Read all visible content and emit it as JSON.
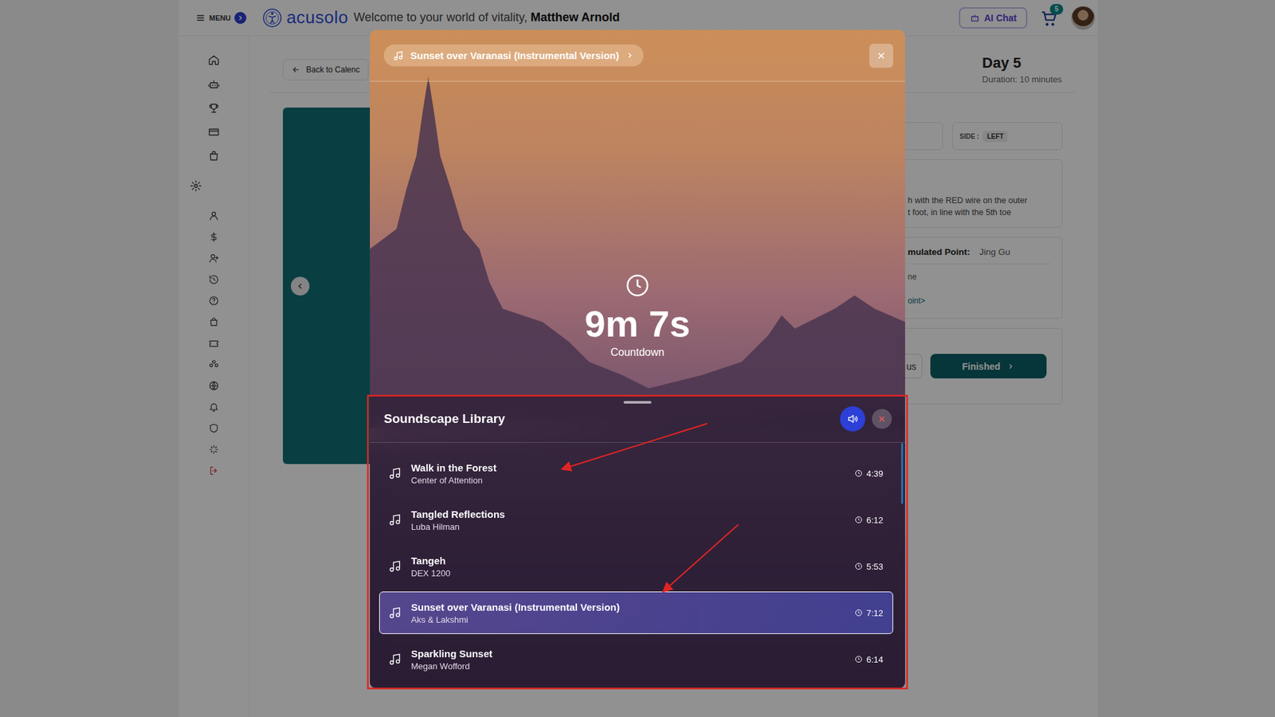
{
  "header": {
    "menu_label": "MENU",
    "logo": "acusolo",
    "welcome": "Welcome to your world of vitality,",
    "user_name": "Matthew Arnold",
    "ai_chat": "AI Chat",
    "cart_count": "5"
  },
  "page": {
    "back_button": "Back to Calenc",
    "day_title": "Day 5",
    "duration": "Duration: 10 minutes",
    "side_label": "SIDE :",
    "side_value": "LEFT",
    "instructions": [
      "h with the RED wire on the outer",
      "t foot, in line with the 5th toe"
    ],
    "point_label": "mulated Point:",
    "point_value": "Jing Gu",
    "point_lines": [
      "ne",
      "oint>"
    ],
    "previous_button": "us",
    "finished_button": "Finished"
  },
  "player": {
    "now_playing": "Sunset over Varanasi (Instrumental Version)",
    "countdown": "9m 7s",
    "countdown_label": "Countdown"
  },
  "library": {
    "title": "Soundscape Library",
    "sound_on": true,
    "tracks": [
      {
        "title": "Walk in the Forest",
        "artist": "Center of Attention",
        "duration": "4:39",
        "selected": false
      },
      {
        "title": "Tangled Reflections",
        "artist": "Luba Hilman",
        "duration": "6:12",
        "selected": false
      },
      {
        "title": "Tangeh",
        "artist": "DEX 1200",
        "duration": "5:53",
        "selected": false
      },
      {
        "title": "Sunset over Varanasi (Instrumental Version)",
        "artist": "Aks & Lakshmi",
        "duration": "7:12",
        "selected": true
      },
      {
        "title": "Sparkling Sunset",
        "artist": "Megan Wofford",
        "duration": "6:14",
        "selected": false
      }
    ]
  }
}
